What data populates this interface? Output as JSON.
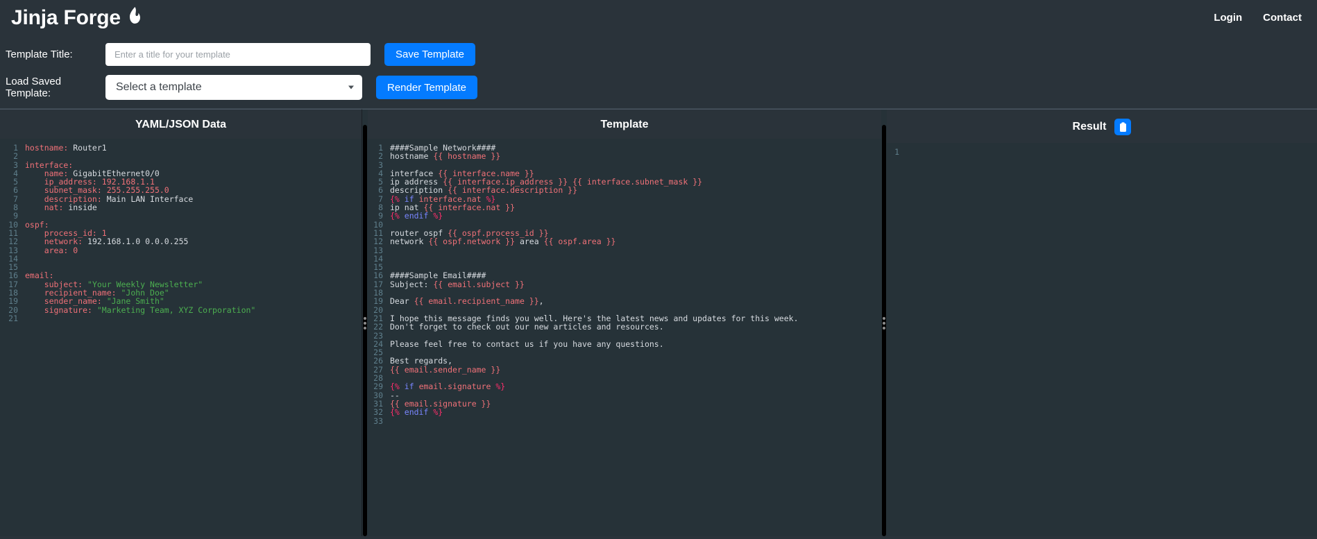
{
  "navbar": {
    "brand": "Jinja Forge",
    "brand_icon": "flame-icon",
    "links": [
      {
        "label": "Login"
      },
      {
        "label": "Contact"
      }
    ]
  },
  "form": {
    "title_label": "Template Title:",
    "title_value": "",
    "title_placeholder": "Enter a title for your template",
    "save_button": "Save Template",
    "load_label": "Load Saved Template:",
    "select_value": "Select a template",
    "render_button": "Render Template"
  },
  "panels": {
    "yaml": {
      "title": "YAML/JSON Data",
      "total_lines": 21,
      "lines": [
        {
          "n": 1,
          "tokens": [
            {
              "t": "hostname:",
              "c": "k"
            },
            {
              "t": " Router1",
              "c": "v"
            }
          ]
        },
        {
          "n": 2,
          "tokens": []
        },
        {
          "n": 3,
          "tokens": [
            {
              "t": "interface:",
              "c": "k"
            }
          ]
        },
        {
          "n": 4,
          "tokens": [
            {
              "t": "    name:",
              "c": "k"
            },
            {
              "t": " GigabitEthernet0/0",
              "c": "v"
            }
          ]
        },
        {
          "n": 5,
          "tokens": [
            {
              "t": "    ip_address:",
              "c": "k"
            },
            {
              "t": " 192.168.1.1",
              "c": "num"
            }
          ]
        },
        {
          "n": 6,
          "tokens": [
            {
              "t": "    subnet_mask:",
              "c": "k"
            },
            {
              "t": " 255.255.255.0",
              "c": "num"
            }
          ]
        },
        {
          "n": 7,
          "tokens": [
            {
              "t": "    description:",
              "c": "k"
            },
            {
              "t": " Main LAN Interface",
              "c": "v"
            }
          ]
        },
        {
          "n": 8,
          "tokens": [
            {
              "t": "    nat:",
              "c": "k"
            },
            {
              "t": " inside",
              "c": "v"
            }
          ]
        },
        {
          "n": 9,
          "tokens": []
        },
        {
          "n": 10,
          "tokens": [
            {
              "t": "ospf:",
              "c": "k"
            }
          ]
        },
        {
          "n": 11,
          "tokens": [
            {
              "t": "    process_id:",
              "c": "k"
            },
            {
              "t": " 1",
              "c": "num"
            }
          ]
        },
        {
          "n": 12,
          "tokens": [
            {
              "t": "    network:",
              "c": "k"
            },
            {
              "t": " 192.168.1.0 0.0.0.255",
              "c": "v"
            }
          ]
        },
        {
          "n": 13,
          "tokens": [
            {
              "t": "    area:",
              "c": "k"
            },
            {
              "t": " 0",
              "c": "num"
            }
          ]
        },
        {
          "n": 14,
          "tokens": []
        },
        {
          "n": 15,
          "tokens": []
        },
        {
          "n": 16,
          "tokens": [
            {
              "t": "email:",
              "c": "k"
            }
          ]
        },
        {
          "n": 17,
          "tokens": [
            {
              "t": "    subject:",
              "c": "k"
            },
            {
              "t": " \"Your Weekly Newsletter\"",
              "c": "str"
            }
          ]
        },
        {
          "n": 18,
          "tokens": [
            {
              "t": "    recipient_name:",
              "c": "k"
            },
            {
              "t": " \"John Doe\"",
              "c": "str"
            }
          ]
        },
        {
          "n": 19,
          "tokens": [
            {
              "t": "    sender_name:",
              "c": "k"
            },
            {
              "t": " \"Jane Smith\"",
              "c": "str"
            }
          ]
        },
        {
          "n": 20,
          "tokens": [
            {
              "t": "    signature:",
              "c": "k"
            },
            {
              "t": " \"Marketing Team, XYZ Corporation\"",
              "c": "str"
            }
          ]
        },
        {
          "n": 21,
          "tokens": []
        }
      ]
    },
    "template": {
      "title": "Template",
      "total_lines": 33,
      "lines": [
        {
          "n": 1,
          "tokens": [
            {
              "t": "####Sample Network####",
              "c": "txt"
            }
          ]
        },
        {
          "n": 2,
          "tokens": [
            {
              "t": "hostname ",
              "c": "txt"
            },
            {
              "t": "{{ hostname }}",
              "c": "jinja"
            }
          ]
        },
        {
          "n": 3,
          "tokens": []
        },
        {
          "n": 4,
          "tokens": [
            {
              "t": "interface ",
              "c": "txt"
            },
            {
              "t": "{{ interface.name }}",
              "c": "jinja"
            }
          ]
        },
        {
          "n": 5,
          "tokens": [
            {
              "t": "ip address ",
              "c": "txt"
            },
            {
              "t": "{{ interface.ip_address }}",
              "c": "jinja"
            },
            {
              "t": " ",
              "c": "txt"
            },
            {
              "t": "{{ interface.subnet_mask }}",
              "c": "jinja"
            }
          ]
        },
        {
          "n": 6,
          "tokens": [
            {
              "t": "description ",
              "c": "txt"
            },
            {
              "t": "{{ interface.description }}",
              "c": "jinja"
            }
          ]
        },
        {
          "n": 7,
          "tokens": [
            {
              "t": "{%",
              "c": "tagp"
            },
            {
              "t": " if ",
              "c": "kw"
            },
            {
              "t": "interface.nat ",
              "c": "jinja"
            },
            {
              "t": "%}",
              "c": "tagp"
            }
          ]
        },
        {
          "n": 8,
          "tokens": [
            {
              "t": "ip nat ",
              "c": "txt"
            },
            {
              "t": "{{ interface.nat }}",
              "c": "jinja"
            }
          ]
        },
        {
          "n": 9,
          "tokens": [
            {
              "t": "{%",
              "c": "tagp"
            },
            {
              "t": " endif ",
              "c": "kw"
            },
            {
              "t": "%}",
              "c": "tagp"
            }
          ]
        },
        {
          "n": 10,
          "tokens": []
        },
        {
          "n": 11,
          "tokens": [
            {
              "t": "router ospf ",
              "c": "txt"
            },
            {
              "t": "{{ ospf.process_id }}",
              "c": "jinja"
            }
          ]
        },
        {
          "n": 12,
          "tokens": [
            {
              "t": "network ",
              "c": "txt"
            },
            {
              "t": "{{ ospf.network }}",
              "c": "jinja"
            },
            {
              "t": " area ",
              "c": "txt"
            },
            {
              "t": "{{ ospf.area }}",
              "c": "jinja"
            }
          ]
        },
        {
          "n": 13,
          "tokens": []
        },
        {
          "n": 14,
          "tokens": []
        },
        {
          "n": 15,
          "tokens": []
        },
        {
          "n": 16,
          "tokens": [
            {
              "t": "####Sample Email####",
              "c": "txt"
            }
          ]
        },
        {
          "n": 17,
          "tokens": [
            {
              "t": "Subject: ",
              "c": "txt"
            },
            {
              "t": "{{ email.subject }}",
              "c": "jinja"
            }
          ]
        },
        {
          "n": 18,
          "tokens": []
        },
        {
          "n": 19,
          "tokens": [
            {
              "t": "Dear ",
              "c": "txt"
            },
            {
              "t": "{{ email.recipient_name }}",
              "c": "jinja"
            },
            {
              "t": ",",
              "c": "txt"
            }
          ]
        },
        {
          "n": 20,
          "tokens": []
        },
        {
          "n": 21,
          "tokens": [
            {
              "t": "I hope this message finds you well. Here's the latest news and updates for this week.",
              "c": "txt"
            }
          ]
        },
        {
          "n": 22,
          "tokens": [
            {
              "t": "Don't forget to check out our new articles and resources.",
              "c": "txt"
            }
          ]
        },
        {
          "n": 23,
          "tokens": []
        },
        {
          "n": 24,
          "tokens": [
            {
              "t": "Please feel free to contact us if you have any questions.",
              "c": "txt"
            }
          ]
        },
        {
          "n": 25,
          "tokens": []
        },
        {
          "n": 26,
          "tokens": [
            {
              "t": "Best regards,",
              "c": "txt"
            }
          ]
        },
        {
          "n": 27,
          "tokens": [
            {
              "t": "{{ email.sender_name }}",
              "c": "jinja"
            }
          ]
        },
        {
          "n": 28,
          "tokens": []
        },
        {
          "n": 29,
          "tokens": [
            {
              "t": "{%",
              "c": "tagp"
            },
            {
              "t": " if ",
              "c": "kw"
            },
            {
              "t": "email.signature ",
              "c": "jinja"
            },
            {
              "t": "%}",
              "c": "tagp"
            }
          ]
        },
        {
          "n": 30,
          "tokens": [
            {
              "t": "--",
              "c": "txt"
            }
          ]
        },
        {
          "n": 31,
          "tokens": [
            {
              "t": "{{ email.signature }}",
              "c": "jinja"
            }
          ]
        },
        {
          "n": 32,
          "tokens": [
            {
              "t": "{%",
              "c": "tagp"
            },
            {
              "t": " endif ",
              "c": "kw"
            },
            {
              "t": "%}",
              "c": "tagp"
            }
          ]
        },
        {
          "n": 33,
          "tokens": []
        }
      ]
    },
    "result": {
      "title": "Result",
      "copy_icon": "clipboard-icon",
      "total_lines": 1,
      "lines": [
        {
          "n": 1,
          "tokens": []
        }
      ]
    }
  },
  "colors": {
    "page_bg": "#2a333a",
    "panel_bg": "#263238",
    "accent_blue": "#047bff",
    "key_red": "#f07178",
    "string_green": "#4caf50",
    "keyword_blue": "#7986ff",
    "tag_pink": "#ff2e6b",
    "linenum": "#5f7f8c"
  }
}
